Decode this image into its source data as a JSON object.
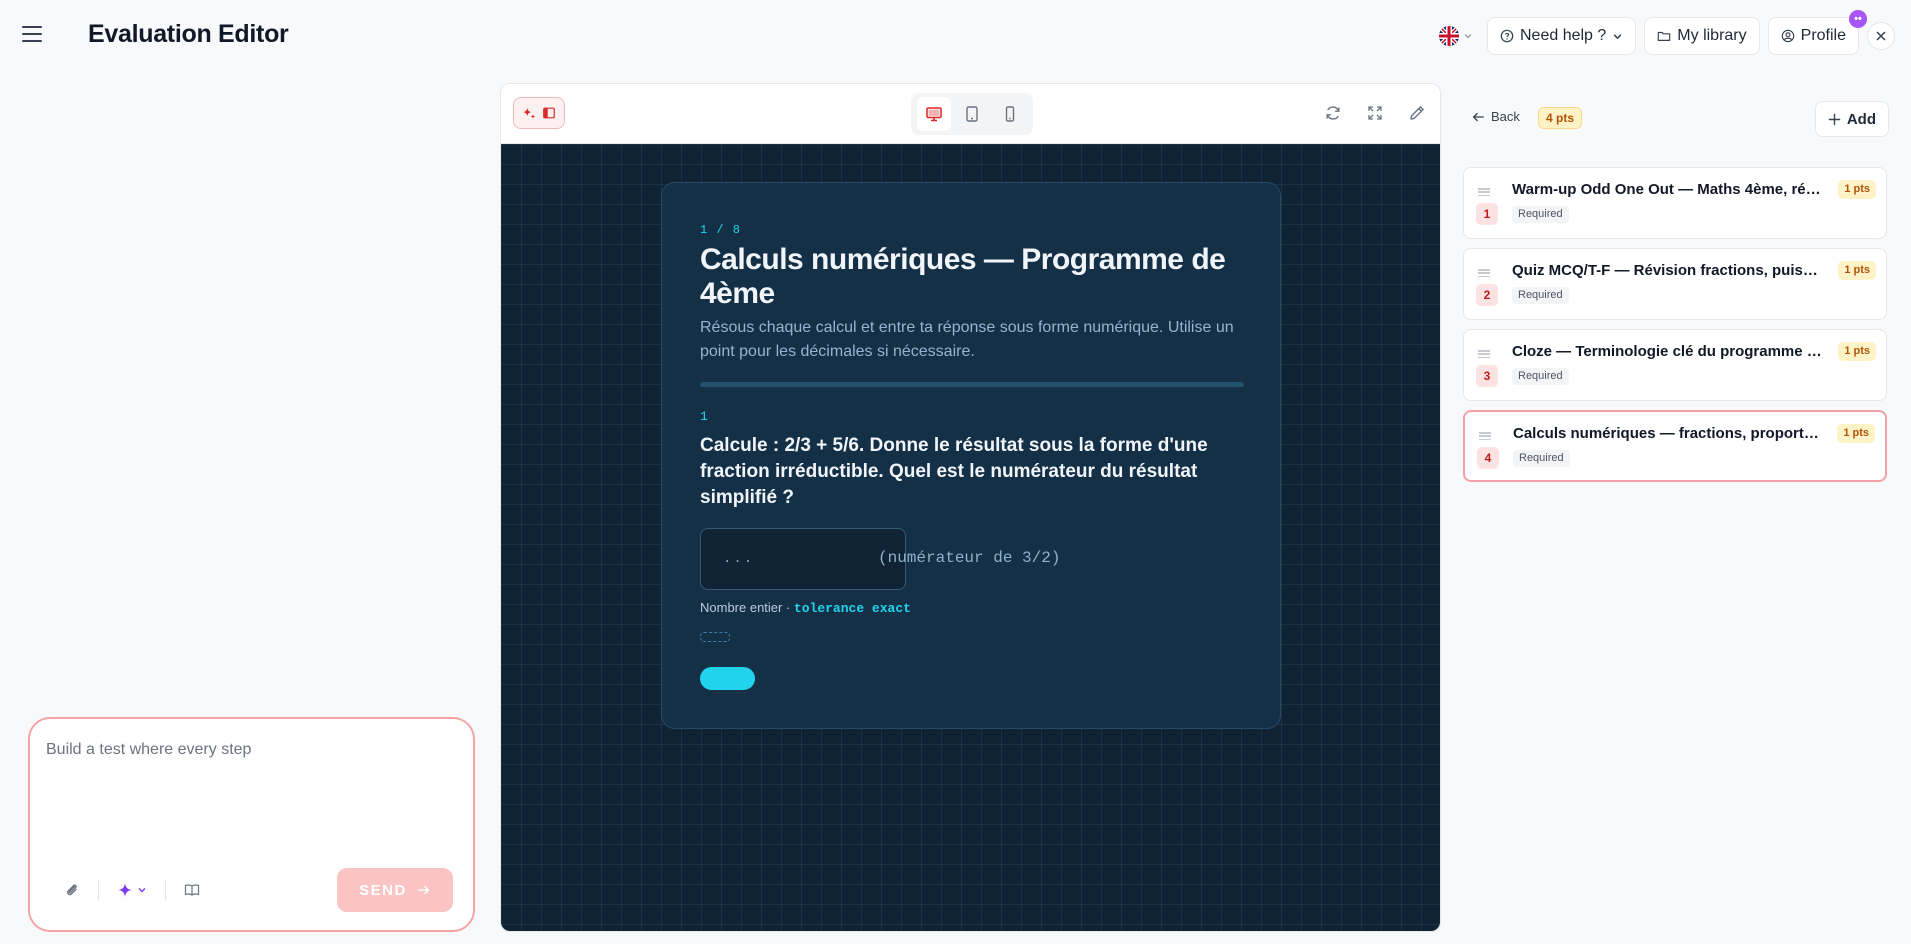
{
  "header": {
    "title": "Evaluation Editor",
    "help_label": "Need help ?",
    "library_label": "My library",
    "profile_label": "Profile",
    "profile_badge": "••"
  },
  "prompt": {
    "placeholder": "Build a test where every step",
    "send_label": "SEND"
  },
  "preview": {
    "counter": "1 / 8",
    "title": "Calculs numériques — Programme de 4ème",
    "subtitle": "Résous chaque calcul et entre ta réponse sous forme numérique. Utilise un point pour les décimales si nécessaire.",
    "question_number": "1",
    "question": "Calcule : 2/3 + 5/6. Donne le résultat sous la forme d'une fraction irréductible. Quel est le numérateur du résultat simplifié ?",
    "answer_placeholder": "...",
    "hint": "(numérateur de 3/2)",
    "meta_prefix": "Nombre entier · ",
    "meta_tolerance": "tolerance exact"
  },
  "sidebar": {
    "back_label": "Back",
    "total_points": "4 pts",
    "add_label": "Add",
    "steps": [
      {
        "number": "1",
        "title": "Warm-up Odd One Out — Maths 4ème, ré…",
        "status": "Required",
        "points": "1 pts"
      },
      {
        "number": "2",
        "title": "Quiz MCQ/T-F — Révision fractions, puiss…",
        "status": "Required",
        "points": "1 pts"
      },
      {
        "number": "3",
        "title": "Cloze — Terminologie clé du programme …",
        "status": "Required",
        "points": "1 pts"
      },
      {
        "number": "4",
        "title": "Calculs numériques — fractions, proporti…",
        "status": "Required",
        "points": "1 pts"
      }
    ]
  },
  "colors": {
    "accent": "#22d3ee",
    "canvas_bg": "#0f2334",
    "card_bg": "#143047",
    "brand_red": "#f4a4a4",
    "points_bg": "#fef3c7"
  },
  "icons": [
    "menu-icon",
    "uk-flag-icon",
    "help-circle-icon",
    "folder-icon",
    "user-icon",
    "close-icon",
    "paperclip-icon",
    "sparkle-icon",
    "book-icon",
    "arrow-right-icon",
    "desktop-icon",
    "tablet-icon",
    "phone-icon",
    "refresh-icon",
    "fullscreen-icon",
    "pencil-icon",
    "arrow-left-icon",
    "plus-icon",
    "drag-handle-icon"
  ]
}
